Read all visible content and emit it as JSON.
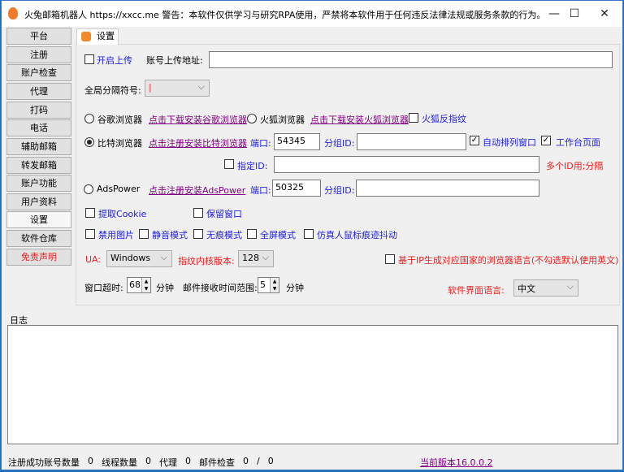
{
  "window": {
    "title": "火兔邮箱机器人  https://xxcc.me 警告：本软件仅供学习与研究RPA使用，严禁将本软件用于任何违反法律法规或服务条款的行为。",
    "minimize": "—",
    "maximize": "☐",
    "close": "✕"
  },
  "sidebar": {
    "items": [
      {
        "label": "平台"
      },
      {
        "label": "注册"
      },
      {
        "label": "账户检查"
      },
      {
        "label": "代理"
      },
      {
        "label": "打码"
      },
      {
        "label": "电话"
      },
      {
        "label": "辅助邮箱"
      },
      {
        "label": "转发邮箱"
      },
      {
        "label": "账户功能"
      },
      {
        "label": "用户资料"
      },
      {
        "label": "设置",
        "selected": true
      },
      {
        "label": "软件仓库"
      },
      {
        "label": "免责声明",
        "color": "#e02020"
      }
    ]
  },
  "tab": {
    "label": "设置"
  },
  "settings": {
    "enable_upload": {
      "label": "开启上传",
      "checked": false
    },
    "upload_url_label": "账号上传地址:",
    "upload_url": "",
    "separator_label": "全局分隔符号:",
    "separator": "|",
    "chrome": {
      "label": "谷歌浏览器",
      "link": "点击下载安装谷歌浏览器",
      "selected": false
    },
    "firefox": {
      "label": "火狐浏览器",
      "link": "点击下载安装火狐浏览器",
      "selected": false
    },
    "firefox_fp": {
      "label": "火狐反指纹",
      "checked": false
    },
    "bit": {
      "label": "比特浏览器",
      "link": "点击注册安装比特浏览器",
      "selected": true,
      "port_label": "端口:",
      "port": "54345",
      "group_label": "分组ID:",
      "group": ""
    },
    "auto_arrange": {
      "label": "自动排列窗口",
      "checked": true
    },
    "workbench": {
      "label": "工作台页面",
      "checked": true
    },
    "specify_id": {
      "label": "指定ID:",
      "checked": false,
      "value": "",
      "hint": "多个ID用;分隔"
    },
    "ads": {
      "label": "AdsPower",
      "link": "点击注册安装AdsPower",
      "selected": false,
      "port_label": "端口:",
      "port": "50325",
      "group_label": "分组ID:",
      "group": ""
    },
    "get_cookie": {
      "label": "提取Cookie",
      "checked": false
    },
    "keep_window": {
      "label": "保留窗口",
      "checked": false
    },
    "disable_images": {
      "label": "禁用图片",
      "checked": false
    },
    "mute": {
      "label": "静音模式",
      "checked": false
    },
    "incognito": {
      "label": "无痕模式",
      "checked": false
    },
    "fullscreen": {
      "label": "全屏模式",
      "checked": false
    },
    "mouse_jitter": {
      "label": "仿真人鼠标痕迹抖动",
      "checked": false
    },
    "ua_label": "UA:",
    "ua": "Windows",
    "kernel_label": "指纹内核版本:",
    "kernel": "128",
    "ip_lang": {
      "label": "基于IP生成对应国家的浏览器语言(不勾选默认使用英文)",
      "checked": false
    },
    "timeout_label": "窗口超时:",
    "timeout": "68",
    "minutes": "分钟",
    "mail_range_label": "邮件接收时间范围:",
    "mail_range": "5",
    "ui_lang_label": "软件界面语言:",
    "ui_lang": "中文"
  },
  "log": {
    "label": "日志",
    "content": ""
  },
  "status": {
    "reg_label": "注册成功账号数量",
    "reg": "0",
    "thread_label": "线程数量",
    "thread": "0",
    "proxy_label": "代理",
    "proxy": "0",
    "mail_label": "邮件检查",
    "mail_done": "0",
    "slash": "/",
    "mail_total": "0",
    "version": "当前版本16.0.0.2"
  }
}
